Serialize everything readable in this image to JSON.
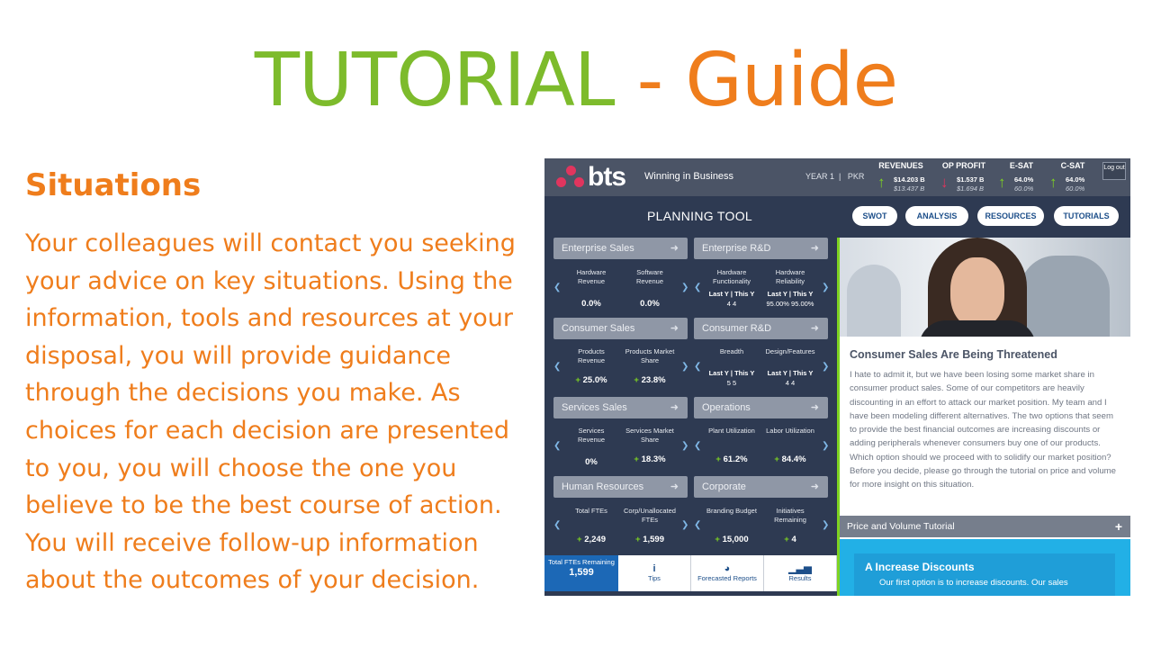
{
  "slide": {
    "title_part1": "TUTORIAL",
    "title_sep": " - ",
    "title_part2": "Guide",
    "heading": "Situations",
    "body": "Your colleagues will contact you seeking your advice on key situations. Using the information, tools and resources at your disposal, you will provide guidance through the decisions you make. As choices for each decision are presented to you, you will choose the one you believe to be the best course of action. You will receive follow-up information about the outcomes of your decision."
  },
  "colors": {
    "green": "#7dbb2c",
    "orange": "#ef7d1c",
    "app_bg": "#2e3a52",
    "accent_blue": "#1c68b6",
    "up": "#7ed321",
    "down": "#e0355e"
  },
  "app": {
    "logo": "bts",
    "name": "Winning in Business",
    "year": "YEAR 1",
    "separator": "|",
    "team": "PKR",
    "metrics": [
      {
        "label": "REVENUES",
        "direction": "up",
        "icon": "arrow-up-icon",
        "value": "$14.203 B",
        "prev": "$13.437 B"
      },
      {
        "label": "OP PROFIT",
        "direction": "down",
        "icon": "arrow-down-icon",
        "value": "$1.537 B",
        "prev": "$1.694 B"
      },
      {
        "label": "E-SAT",
        "direction": "up",
        "icon": "arrow-up-icon",
        "value": "64.0%",
        "prev": "60.0%"
      },
      {
        "label": "C-SAT",
        "direction": "up",
        "icon": "arrow-up-icon",
        "value": "64.0%",
        "prev": "60.0%"
      }
    ],
    "logout": "Log out",
    "tool_title": "PLANNING TOOL",
    "tabs": [
      "SWOT",
      "ANALYSIS",
      "RESOURCES",
      "TUTORIALS"
    ],
    "categories": [
      {
        "title": "Enterprise Sales",
        "cells": [
          {
            "label": "Hardware Revenue",
            "value": "0.0%"
          },
          {
            "label": "Software Revenue",
            "value": "0.0%"
          }
        ]
      },
      {
        "title": "Enterprise R&D",
        "cells": [
          {
            "label": "Hardware Functionality",
            "ly": "Last Y  |  This Y",
            "vals": "4        4"
          },
          {
            "label": "Hardware Reliability",
            "ly": "Last Y  |  This Y",
            "vals": "95.00% 95.00%"
          }
        ]
      },
      {
        "title": "Consumer Sales",
        "cells": [
          {
            "label": "Products Revenue",
            "value": "25.0%"
          },
          {
            "label": "Products Market Share",
            "value": "23.8%"
          }
        ]
      },
      {
        "title": "Consumer R&D",
        "cells": [
          {
            "label": "Breadth",
            "ly": "Last Y  |  This Y",
            "vals": "5        5"
          },
          {
            "label": "Design/Features",
            "ly": "Last Y  |  This Y",
            "vals": "4        4"
          }
        ]
      },
      {
        "title": "Services Sales",
        "cells": [
          {
            "label": "Services Revenue",
            "value": "0%"
          },
          {
            "label": "Services Market Share",
            "value": "18.3%"
          }
        ]
      },
      {
        "title": "Operations",
        "cells": [
          {
            "label": "Plant Utilization",
            "value": "61.2%"
          },
          {
            "label": "Labor Utilization",
            "value": "84.4%"
          }
        ]
      },
      {
        "title": "Human Resources",
        "cells": [
          {
            "label": "Total FTEs",
            "value": "2,249"
          },
          {
            "label": "Corp/Unallocated FTEs",
            "value": "1,599"
          }
        ]
      },
      {
        "title": "Corporate",
        "cells": [
          {
            "label": "Branding Budget",
            "value": "15,000"
          },
          {
            "label": "Initiatives Remaining",
            "value": "4"
          }
        ]
      }
    ],
    "plus": "+",
    "arrow_glyph": "➜",
    "bottom_nav": {
      "total_label": "Total FTEs Remaining",
      "total_value": "1,599",
      "tips": "Tips",
      "reports": "Forecasted Reports",
      "results": "Results"
    },
    "article": {
      "title": "Consumer Sales Are Being Threatened",
      "body": "I hate to admit it, but we have been losing some market share in consumer product sales. Some of our competitors are heavily discounting in an effort to attack our market position. My team and I have been modeling different alternatives. The two options that seem to provide the best financial outcomes are increasing discounts or adding peripherals whenever consumers buy one of our products. Which option should we proceed with to solidify our market position? Before you decide, please go through the tutorial on price and volume for more insight on this situation."
    },
    "tutorial_bar": "Price and Volume Tutorial",
    "option_a_title": "A  Increase Discounts",
    "option_a_text": "Our first option is to increase discounts. Our sales"
  }
}
